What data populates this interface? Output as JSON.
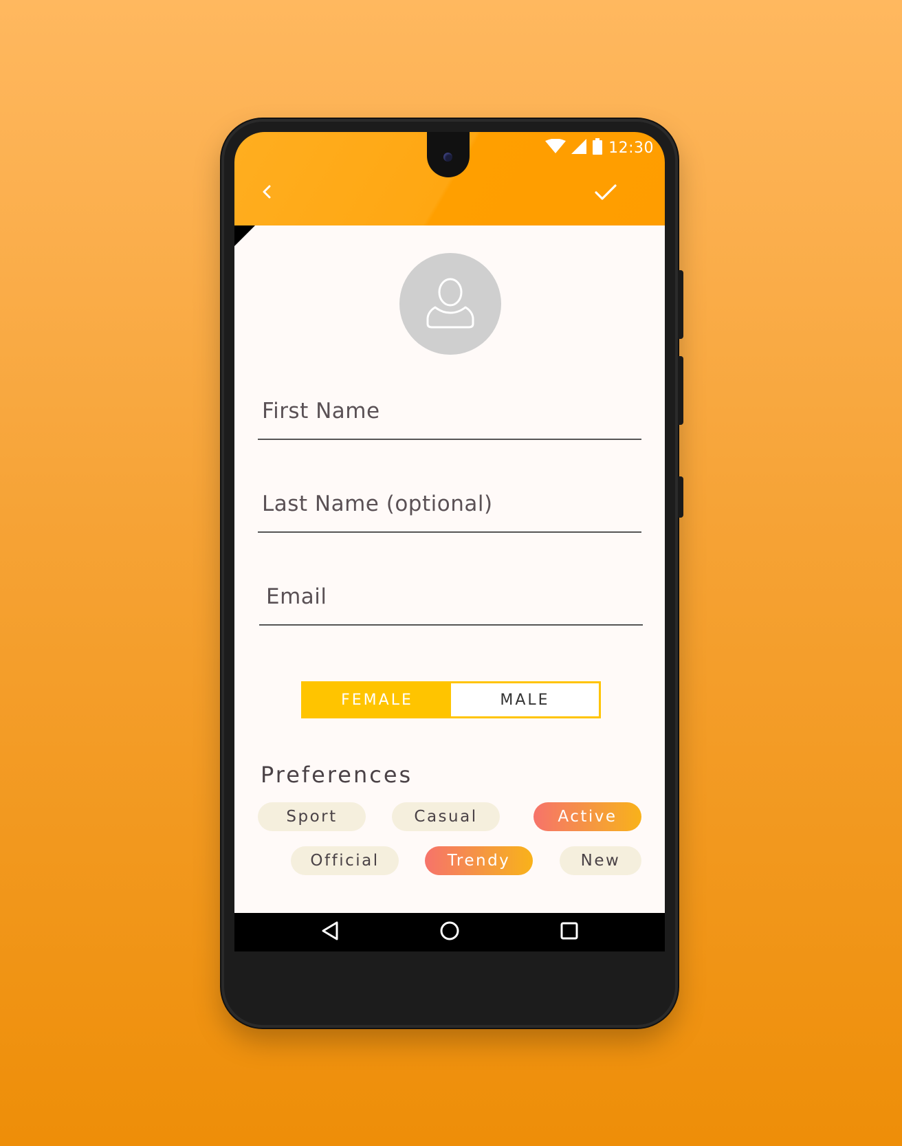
{
  "status_bar": {
    "time": "12:30"
  },
  "app_bar": {
    "back_icon": "chevron-left-icon",
    "confirm_icon": "check-icon"
  },
  "avatar": {
    "icon": "user-icon"
  },
  "form": {
    "first_name": {
      "placeholder": "First Name",
      "value": ""
    },
    "last_name": {
      "placeholder": "Last Name (optional)",
      "value": ""
    },
    "email": {
      "placeholder": "Email",
      "value": ""
    }
  },
  "gender": {
    "options": [
      {
        "label": "FEMALE",
        "selected": true
      },
      {
        "label": "MALE",
        "selected": false
      }
    ]
  },
  "preferences": {
    "title": "Preferences",
    "chips": [
      {
        "label": "Sport",
        "selected": false
      },
      {
        "label": "Casual",
        "selected": false
      },
      {
        "label": "Active",
        "selected": true
      },
      {
        "label": "Official",
        "selected": false
      },
      {
        "label": "Trendy",
        "selected": true
      },
      {
        "label": "New",
        "selected": false
      }
    ]
  },
  "nav_bar": {
    "back": "triangle-back-icon",
    "home": "circle-home-icon",
    "recents": "square-recents-icon"
  },
  "colors": {
    "accent": "#ffa300",
    "toggle": "#ffc400",
    "chip_gradient_start": "#f6736a",
    "chip_gradient_end": "#f9b21a"
  }
}
